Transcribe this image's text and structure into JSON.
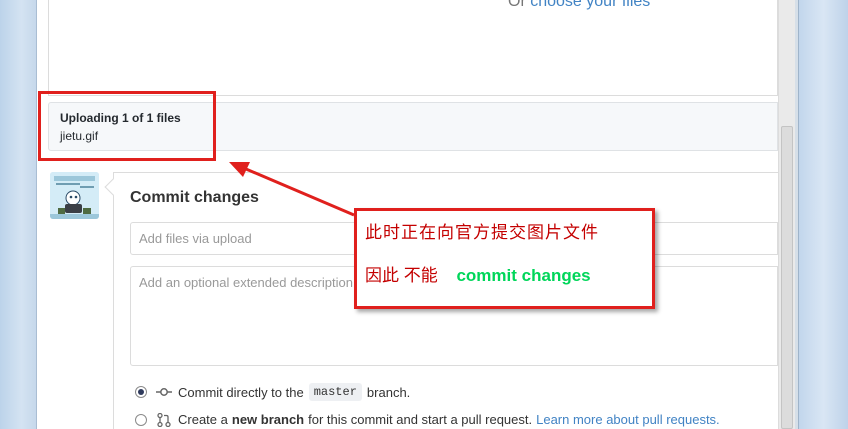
{
  "dropzone": {
    "or_text": "Or",
    "choose_link": "choose your files"
  },
  "upload": {
    "title": "Uploading 1 of 1 files",
    "file_name": "jietu.gif"
  },
  "commit": {
    "title": "Commit changes",
    "summary_placeholder": "Add files via upload",
    "description_placeholder": "Add an optional extended description…",
    "option_direct": {
      "prefix": "Commit directly to the",
      "branch": "master",
      "suffix": "branch.",
      "selected": true
    },
    "option_new_branch": {
      "prefix": "Create a",
      "bold": "new branch",
      "suffix": "for this commit and start a pull request.",
      "link": "Learn more about pull requests.",
      "selected": false
    }
  },
  "annotation": {
    "line1": "此时正在向官方提交图片文件",
    "line2_prefix": "因此  不能",
    "line2_highlight": "commit changes",
    "color_border": "#e0201d",
    "color_text": "#c40000",
    "color_highlight": "#00d65a"
  },
  "icons": {
    "commit": "git-commit-icon",
    "pull_request": "git-pull-request-icon",
    "avatar": "user-avatar"
  }
}
